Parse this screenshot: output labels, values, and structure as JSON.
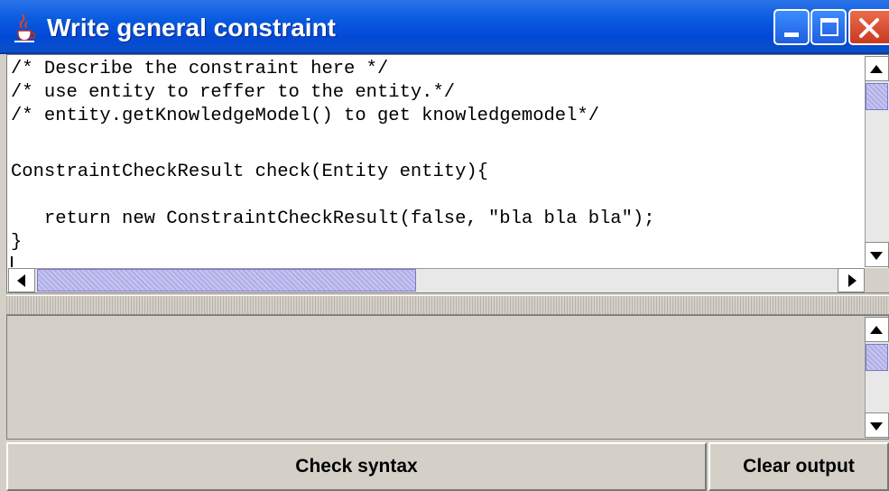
{
  "window": {
    "title": "Write general constraint",
    "icon": "java-cup-icon",
    "controls": [
      "minimize",
      "maximize",
      "close"
    ]
  },
  "editor": {
    "lines": [
      "/* Describe the constraint here */",
      "/* use entity to reffer to the entity.*/",
      "/* entity.getKnowledgeModel() to get knowledgemodel*/",
      "",
      "ConstraintCheckResult check(Entity entity){",
      "",
      "   return new ConstraintCheckResult(false, \"bla bla bla\");",
      "}"
    ]
  },
  "output": {
    "text": ""
  },
  "buttons": {
    "check_syntax": "Check syntax",
    "clear_output": "Clear output"
  },
  "colors": {
    "titlebar": "#0a5ce0",
    "scroll_thumb": "#c7c5f0",
    "close_button": "#d9482b",
    "panel": "#d4d0c8"
  }
}
